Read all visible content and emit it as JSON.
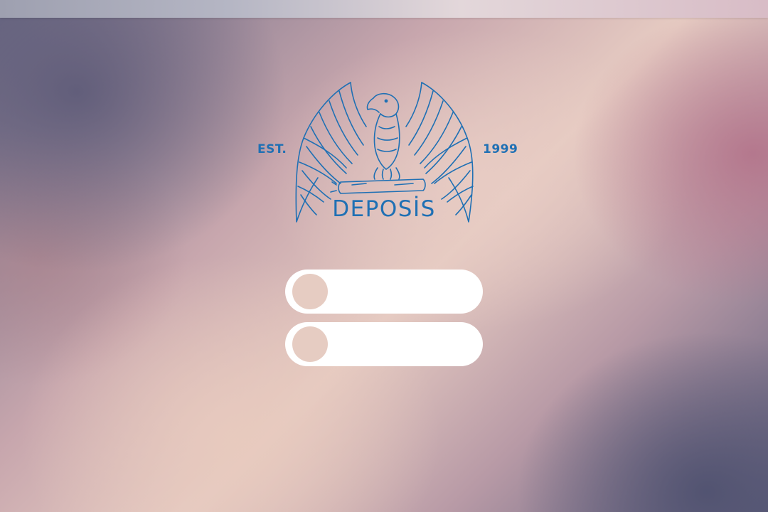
{
  "logo": {
    "est": "EST.",
    "year": "1999",
    "brand": "DEPOSİS",
    "color": "#1f70b4",
    "icon": "eagle-icon"
  },
  "login": {
    "username": {
      "value": "",
      "placeholder": "",
      "icon": "user-icon"
    },
    "password": {
      "value": "",
      "placeholder": "",
      "icon": "lock-icon"
    }
  },
  "colors": {
    "accent": "#1f70b4",
    "field_bg": "#ffffff",
    "icon_circle": "#e6ccc2"
  }
}
